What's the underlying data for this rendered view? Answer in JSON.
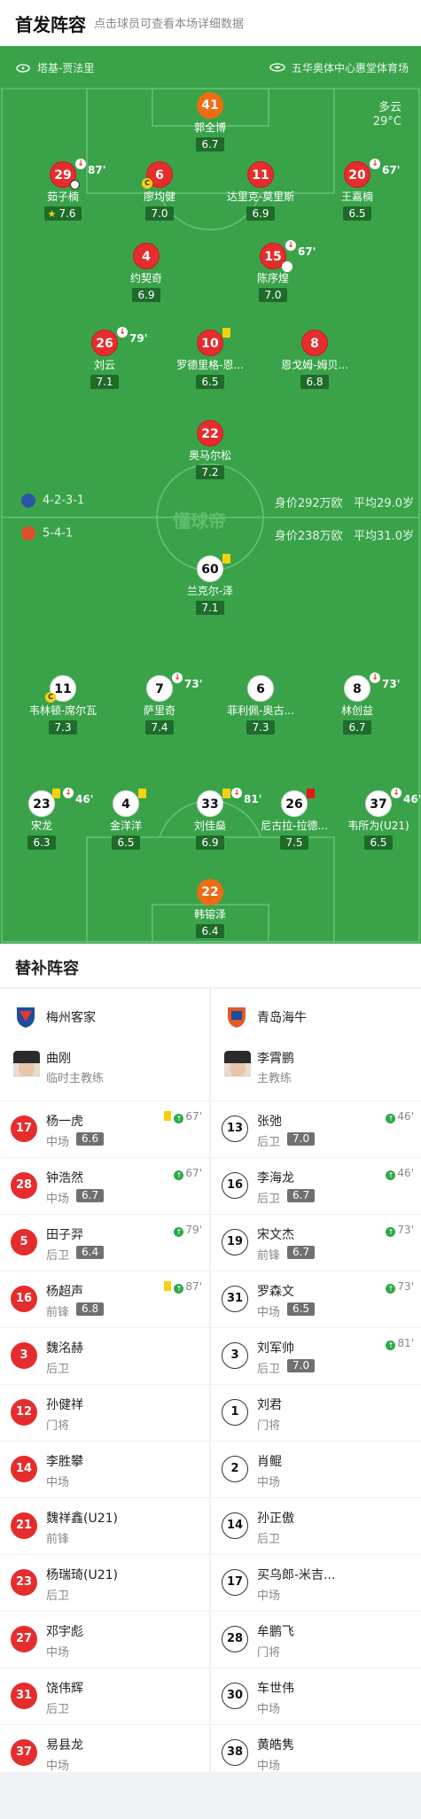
{
  "header": {
    "title": "首发阵容",
    "subtitle": "点击球员可查看本场详细数据"
  },
  "pitch": {
    "referee": "塔基-贾法里",
    "venue": "五华奥体中心惠堂体育场",
    "weather": "多云",
    "temperature": "29°C",
    "home": {
      "formation": "4-2-3-1",
      "value": "身价292万欧",
      "age": "平均29.0岁"
    },
    "away": {
      "formation": "5-4-1",
      "value": "身价238万欧",
      "age": "平均31.0岁"
    },
    "watermark": "懂球帝"
  },
  "home_players": [
    {
      "num": "41",
      "name": "郭全博",
      "rating": "6.7",
      "color": "orange"
    },
    {
      "num": "29",
      "name": "茹子楠",
      "rating": "7.6",
      "color": "red",
      "sub": "87'"
    },
    {
      "num": "6",
      "name": "廖均健",
      "rating": "7.0",
      "color": "red"
    },
    {
      "num": "11",
      "name": "达里克-莫里斯",
      "rating": "6.9",
      "color": "red"
    },
    {
      "num": "20",
      "name": "王嘉楠",
      "rating": "6.5",
      "color": "red",
      "sub": "67'"
    },
    {
      "num": "4",
      "name": "约契奇",
      "rating": "6.9",
      "color": "red"
    },
    {
      "num": "15",
      "name": "陈序煌",
      "rating": "7.0",
      "color": "red",
      "sub": "67'"
    },
    {
      "num": "26",
      "name": "刘云",
      "rating": "7.1",
      "color": "red",
      "sub": "79'"
    },
    {
      "num": "10",
      "name": "罗德里格-恩...",
      "rating": "6.5",
      "color": "red"
    },
    {
      "num": "8",
      "name": "恩戈姆-姆贝...",
      "rating": "6.8",
      "color": "red"
    },
    {
      "num": "22",
      "name": "奥马尔松",
      "rating": "7.2",
      "color": "red"
    }
  ],
  "away_players": [
    {
      "num": "60",
      "name": "兰克尔-泽",
      "rating": "7.1"
    },
    {
      "num": "11",
      "name": "韦林顿-席尔瓦",
      "rating": "7.3"
    },
    {
      "num": "7",
      "name": "萨里奇",
      "rating": "7.4",
      "sub": "73'"
    },
    {
      "num": "6",
      "name": "菲利佩-奥古...",
      "rating": "7.3"
    },
    {
      "num": "8",
      "name": "林创益",
      "rating": "6.7",
      "sub": "73'"
    },
    {
      "num": "23",
      "name": "宋龙",
      "rating": "6.3",
      "sub": "46'"
    },
    {
      "num": "4",
      "name": "金洋洋",
      "rating": "6.5"
    },
    {
      "num": "33",
      "name": "刘佳燊",
      "rating": "6.9",
      "sub": "81'"
    },
    {
      "num": "26",
      "name": "尼古拉-拉德...",
      "rating": "7.5"
    },
    {
      "num": "37",
      "name": "韦所为(U21)",
      "rating": "6.5",
      "sub": "46'"
    },
    {
      "num": "22",
      "name": "韩镕泽",
      "rating": "6.4",
      "color": "orange"
    }
  ],
  "subs": {
    "title": "替补阵容",
    "home": {
      "team": "梅州客家",
      "coach": {
        "name": "曲刚",
        "role": "临时主教练"
      },
      "players": [
        {
          "num": "17",
          "name": "杨一虎",
          "pos": "中场",
          "rating": "6.6",
          "in": "67'",
          "yellow": true
        },
        {
          "num": "28",
          "name": "钟浩然",
          "pos": "中场",
          "rating": "6.7",
          "in": "67'"
        },
        {
          "num": "5",
          "name": "田子羿",
          "pos": "后卫",
          "rating": "6.4",
          "in": "79'"
        },
        {
          "num": "16",
          "name": "杨超声",
          "pos": "前锋",
          "rating": "6.8",
          "in": "87'",
          "yellow": true
        },
        {
          "num": "3",
          "name": "魏洺赫",
          "pos": "后卫"
        },
        {
          "num": "12",
          "name": "孙健祥",
          "pos": "门将"
        },
        {
          "num": "14",
          "name": "李胜攀",
          "pos": "中场"
        },
        {
          "num": "21",
          "name": "魏祥鑫(U21)",
          "pos": "前锋"
        },
        {
          "num": "23",
          "name": "杨瑞琦(U21)",
          "pos": "后卫"
        },
        {
          "num": "27",
          "name": "邓宇彪",
          "pos": "中场"
        },
        {
          "num": "31",
          "name": "饶伟辉",
          "pos": "后卫"
        },
        {
          "num": "37",
          "name": "易县龙",
          "pos": "中场"
        }
      ]
    },
    "away": {
      "team": "青岛海牛",
      "coach": {
        "name": "李霄鹏",
        "role": "主教练"
      },
      "players": [
        {
          "num": "13",
          "name": "张弛",
          "pos": "后卫",
          "rating": "7.0",
          "in": "46'"
        },
        {
          "num": "16",
          "name": "李海龙",
          "pos": "后卫",
          "rating": "6.7",
          "in": "46'"
        },
        {
          "num": "19",
          "name": "宋文杰",
          "pos": "前锋",
          "rating": "6.7",
          "in": "73'"
        },
        {
          "num": "31",
          "name": "罗森文",
          "pos": "中场",
          "rating": "6.5",
          "in": "73'"
        },
        {
          "num": "3",
          "name": "刘军帅",
          "pos": "后卫",
          "rating": "7.0",
          "in": "81'"
        },
        {
          "num": "1",
          "name": "刘君",
          "pos": "门将"
        },
        {
          "num": "2",
          "name": "肖鲲",
          "pos": "中场"
        },
        {
          "num": "14",
          "name": "孙正傲",
          "pos": "后卫"
        },
        {
          "num": "17",
          "name": "买乌郎-米吉...",
          "pos": "中场"
        },
        {
          "num": "28",
          "name": "牟鹏飞",
          "pos": "门将"
        },
        {
          "num": "30",
          "name": "车世伟",
          "pos": "中场"
        },
        {
          "num": "38",
          "name": "黄皓隽",
          "pos": "中场"
        }
      ]
    }
  }
}
